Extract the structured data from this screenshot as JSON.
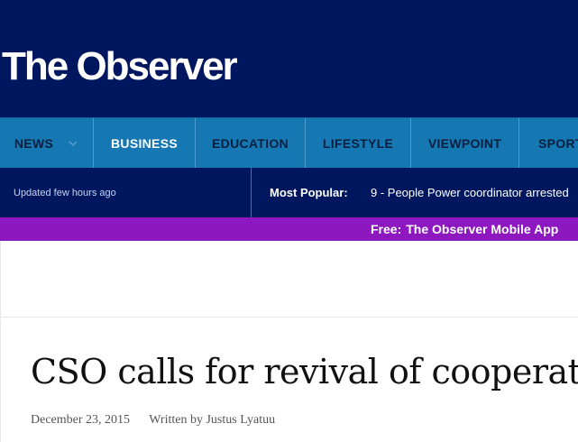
{
  "site": {
    "logo_text": "The Observer"
  },
  "nav": {
    "items": [
      {
        "label": "NEWS",
        "has_dropdown": true
      },
      {
        "label": "BUSINESS",
        "active": true
      },
      {
        "label": "EDUCATION"
      },
      {
        "label": "LIFESTYLE"
      },
      {
        "label": "VIEWPOINT"
      },
      {
        "label": "SPORTS"
      }
    ]
  },
  "ticker": {
    "updated_text": "Updated few hours ago",
    "most_popular_label": "Most Popular:",
    "most_popular_item": "9 - People Power coordinator arrested"
  },
  "promo": {
    "label": "Free:",
    "link_text": "The Observer Mobile App"
  },
  "article": {
    "headline": "CSO calls for revival of cooperatives",
    "date": "December 23, 2015",
    "byline": "Written by Justus Lyatuu"
  },
  "colors": {
    "masthead_bg": "#001760",
    "nav_bg": "#1578b3",
    "promo_bg": "#8e18c0"
  },
  "icons": {
    "nav_dropdown": "chevron-down-icon"
  }
}
